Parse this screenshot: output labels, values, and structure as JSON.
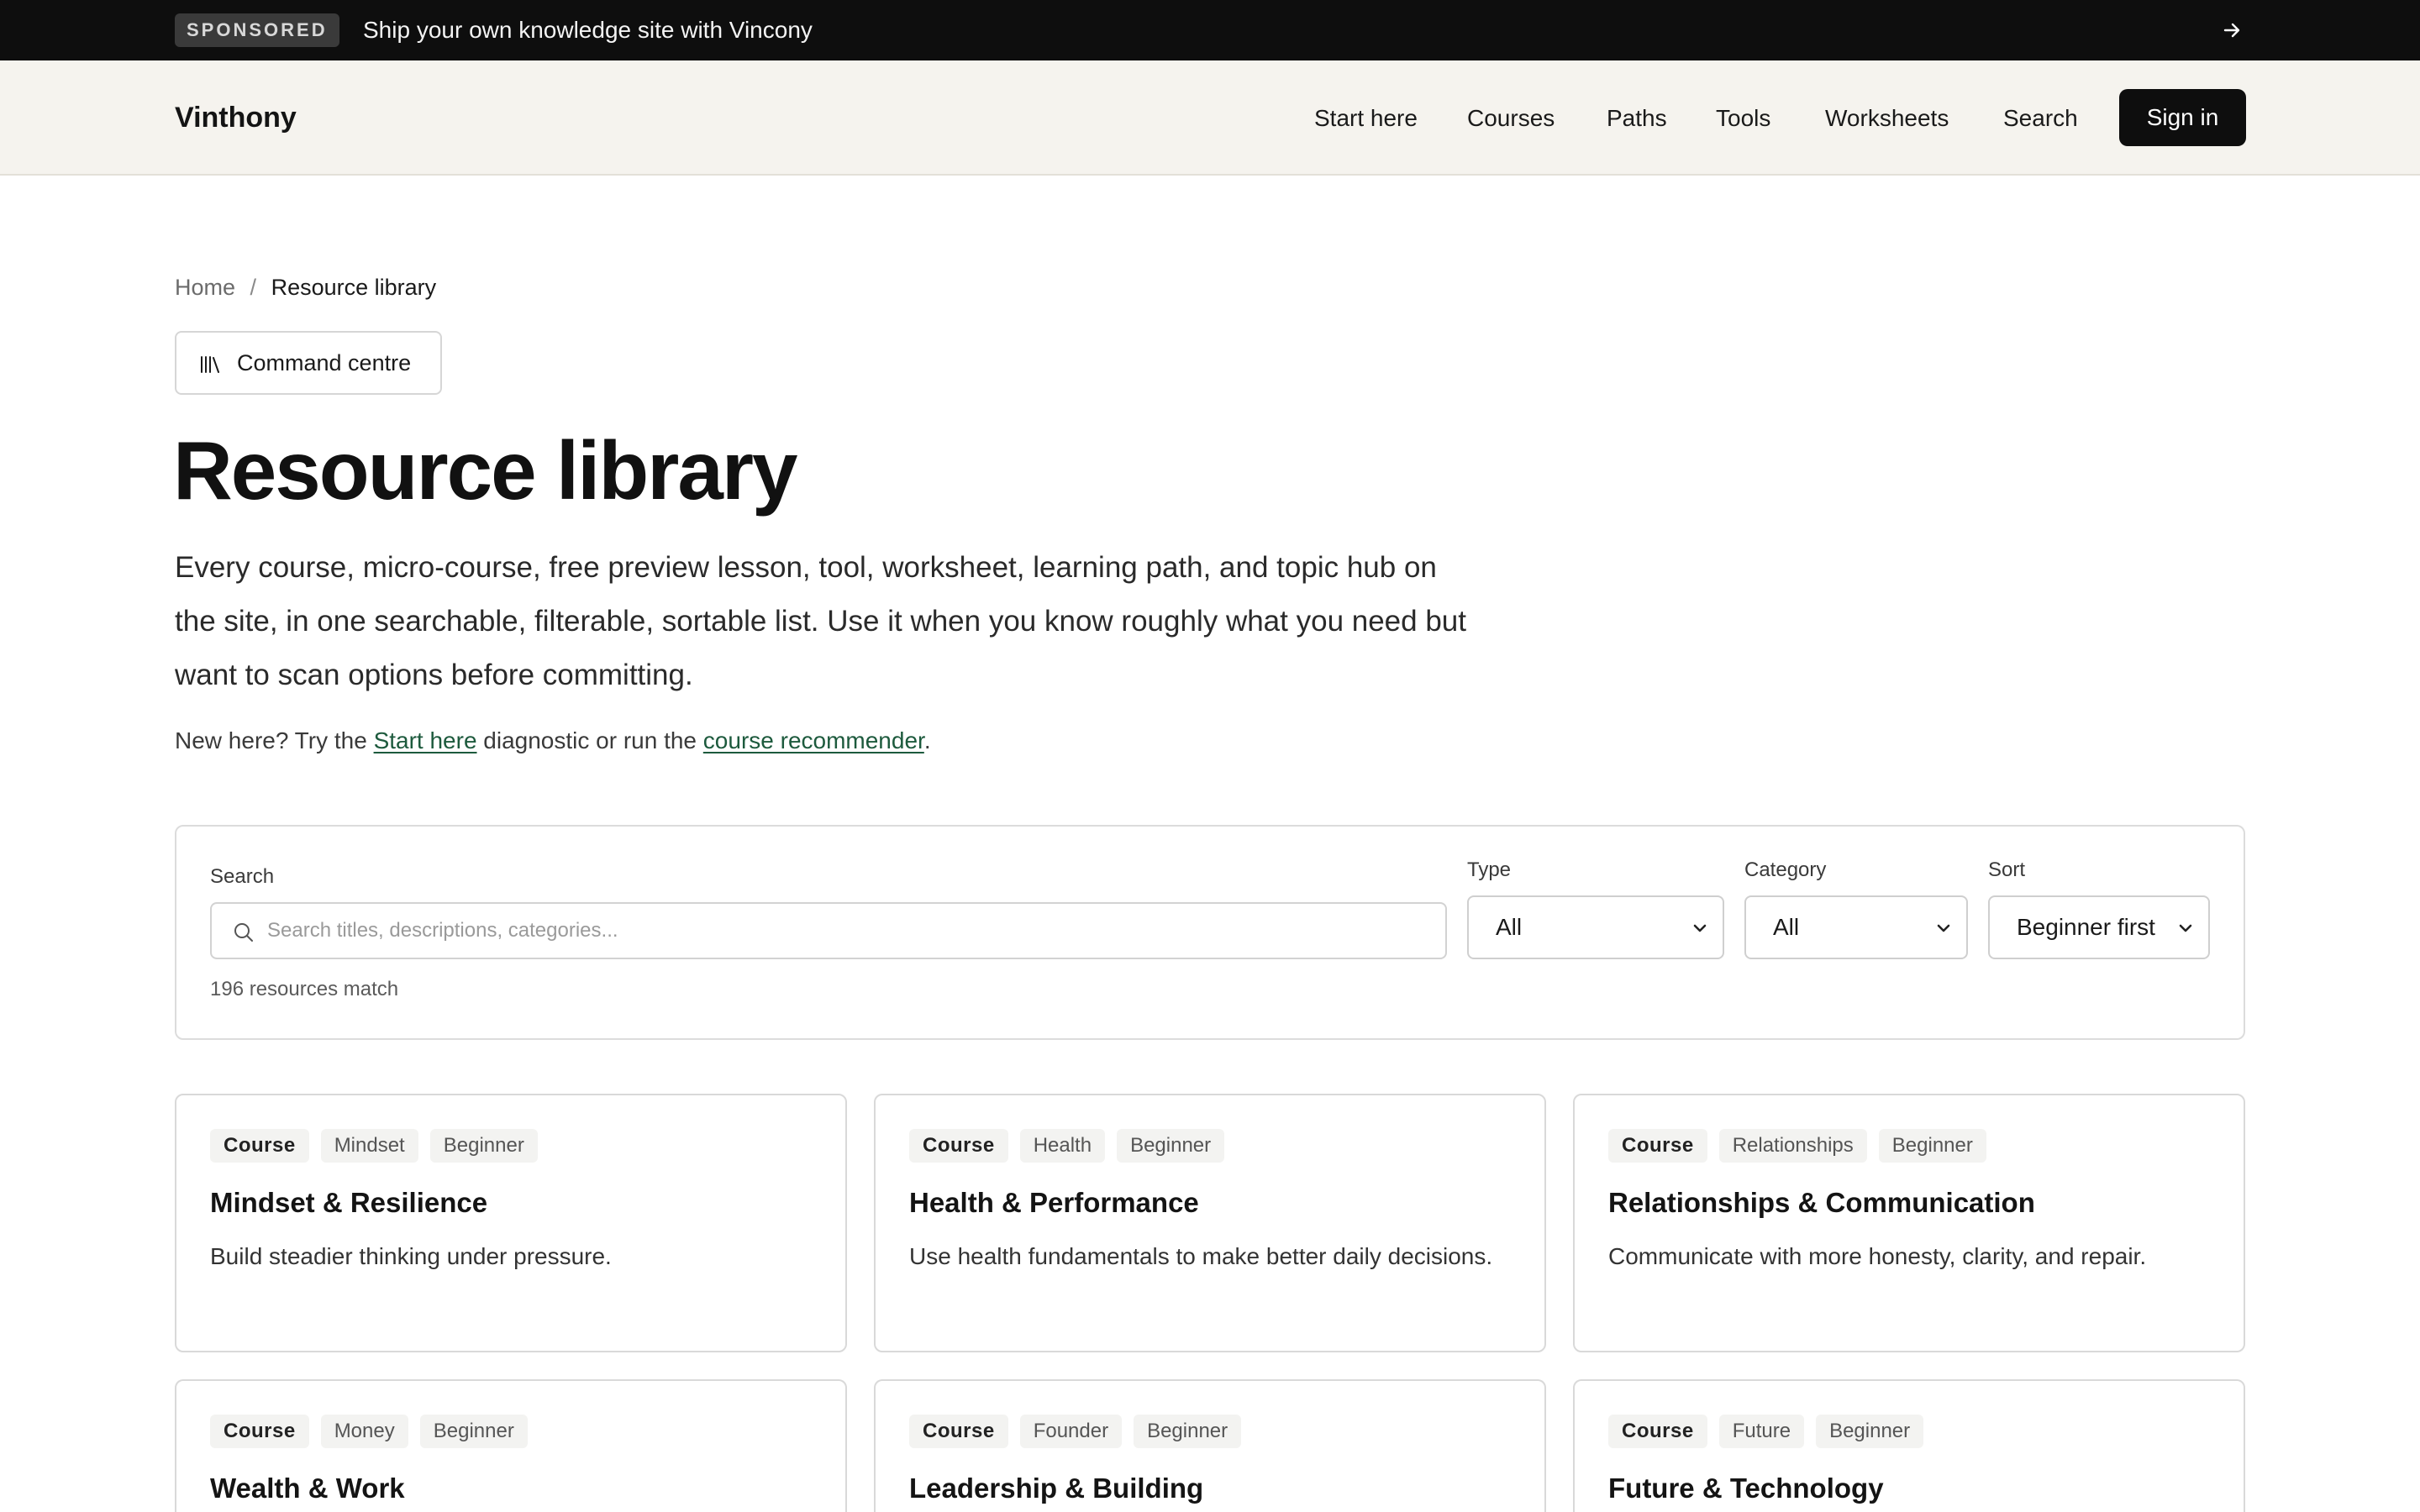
{
  "sponsor": {
    "badge": "SPONSORED",
    "text": "Ship your own knowledge site with Vincony"
  },
  "header": {
    "brand": "Vinthony",
    "nav": [
      "Start here",
      "Courses",
      "Paths",
      "Tools",
      "Worksheets",
      "Search"
    ],
    "signin": "Sign in"
  },
  "breadcrumb": {
    "home": "Home",
    "separator": "/",
    "current": "Resource library"
  },
  "command_centre": {
    "label": "Command centre",
    "icon": "library-icon"
  },
  "page": {
    "title": "Resource library",
    "intro": "Every course, micro-course, free preview lesson, tool, worksheet, learning path, and topic hub on the site, in one searchable, filterable, sortable list. Use it when you know roughly what you need but want to scan options before committing.",
    "newhere": {
      "prefix": "New here? Try the ",
      "link1": "Start here",
      "middle": " diagnostic or run the ",
      "link2": "course recommender",
      "suffix": "."
    }
  },
  "filters": {
    "search_label": "Search",
    "search_placeholder": "Search titles, descriptions, categories...",
    "type_label": "Type",
    "type_value": "All",
    "category_label": "Category",
    "category_value": "All",
    "sort_label": "Sort",
    "sort_value": "Beginner first",
    "match_count": "196 resources match"
  },
  "cards": [
    {
      "type": "Course",
      "category": "Mindset",
      "level": "Beginner",
      "title": "Mindset & Resilience",
      "desc": "Build steadier thinking under pressure."
    },
    {
      "type": "Course",
      "category": "Health",
      "level": "Beginner",
      "title": "Health & Performance",
      "desc": "Use health fundamentals to make better daily decisions."
    },
    {
      "type": "Course",
      "category": "Relationships",
      "level": "Beginner",
      "title": "Relationships & Communication",
      "desc": "Communicate with more honesty, clarity, and repair."
    },
    {
      "type": "Course",
      "category": "Money",
      "level": "Beginner",
      "title": "Wealth & Work",
      "desc": ""
    },
    {
      "type": "Course",
      "category": "Founder",
      "level": "Beginner",
      "title": "Leadership & Building",
      "desc": ""
    },
    {
      "type": "Course",
      "category": "Future",
      "level": "Beginner",
      "title": "Future & Technology",
      "desc": ""
    }
  ],
  "colors": {
    "sponsor_bg": "#0e0e0e",
    "header_bg": "#f5f3ee",
    "link": "#1d5a3d",
    "button_bg": "#0e0e0e"
  }
}
